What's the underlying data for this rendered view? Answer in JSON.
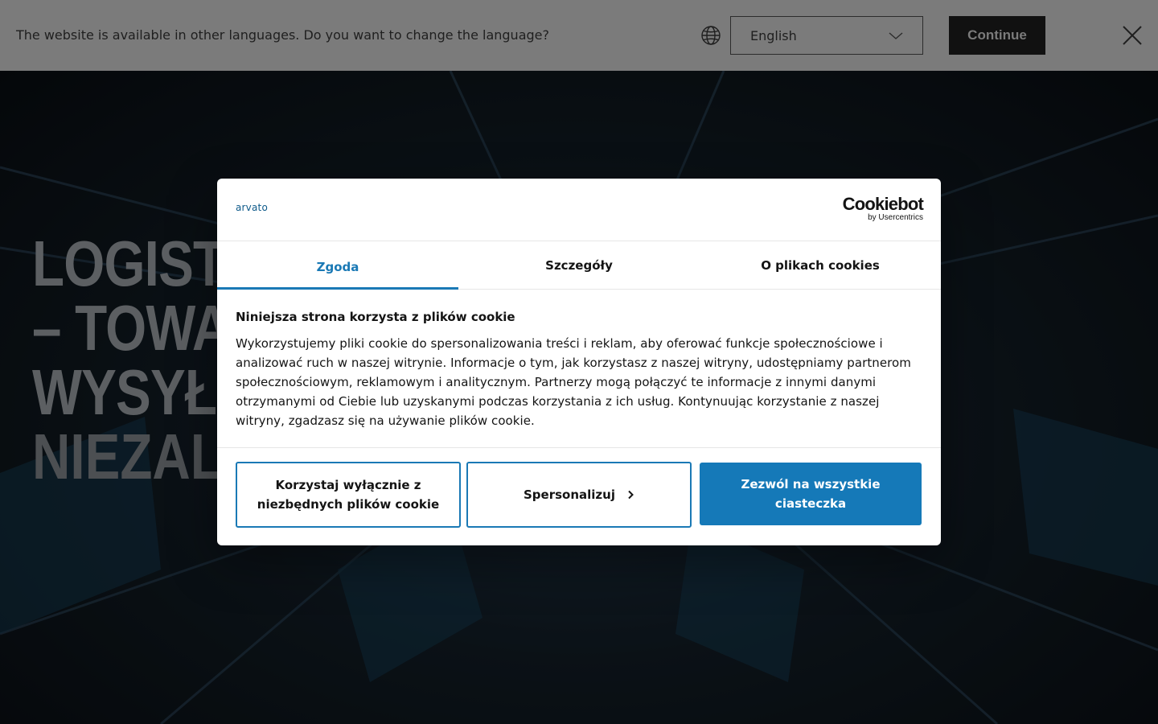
{
  "language_bar": {
    "message": "The website is available in other languages. Do you want to change the language?",
    "selected_language": "English",
    "continue_label": "Continue"
  },
  "hero": {
    "title": "LOGISTYKA E-COMMERCE PROSTA\n– TOWAR MAGAZYNOWANY ORAZ\nWYSYŁANY",
    "subtitle": "NIEZALEŻNIE OD TEGO, CZY DUŻO"
  },
  "cookie_dialog": {
    "brand": "arvato",
    "cookiebot_name": "Cookiebot",
    "cookiebot_byline": "by Usercentrics",
    "tabs": [
      {
        "label": "Zgoda",
        "active": true
      },
      {
        "label": "Szczegóły",
        "active": false
      },
      {
        "label": "O plikach cookies",
        "active": false
      }
    ],
    "heading": "Niniejsza strona korzysta z plików cookie",
    "body": "Wykorzystujemy pliki cookie do spersonalizowania treści i reklam, aby oferować funkcje społecznościowe i analizować ruch w naszej witrynie. Informacje o tym, jak korzystasz z naszej witryny, udostępniamy partnerom społecznościowym, reklamowym i analitycznym. Partnerzy mogą połączyć te informacje z innymi danymi otrzymanymi od Ciebie lub uzyskanymi podczas korzystania z ich usług. Kontynuując korzystanie z naszej witryny, zgadzasz się na używanie plików cookie.",
    "buttons": {
      "necessary": "Korzystaj wyłącznie z niezbędnych plików cookie",
      "customize": "Spersonalizuj",
      "allow_all": "Zezwól na wszystkie ciasteczka"
    }
  },
  "colors": {
    "accent": "#1a79b5",
    "language_bar_bg": "#7b7b7b",
    "continue_bg": "#111111"
  }
}
